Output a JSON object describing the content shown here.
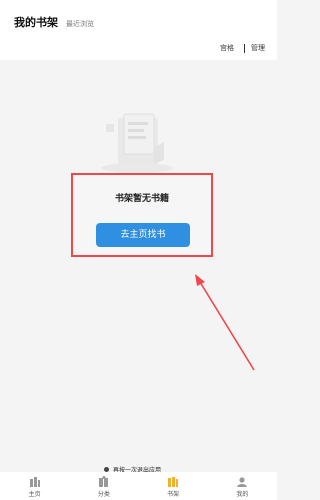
{
  "header": {
    "tab_active": "我的书架",
    "tab_inactive": "最近浏览",
    "tool_grid": "宫格",
    "tool_manage": "管理"
  },
  "empty_state": {
    "title": "书架暂无书籍",
    "button": "去主页找书"
  },
  "toast": {
    "text": "再按一次退出应用"
  },
  "bottom_nav": {
    "items": [
      {
        "label": "主页",
        "icon": "book-stack-icon"
      },
      {
        "label": "分类",
        "icon": "category-icon"
      },
      {
        "label": "书架",
        "icon": "bookshelf-icon",
        "active": true
      },
      {
        "label": "我的",
        "icon": "user-icon"
      }
    ]
  },
  "colors": {
    "accent": "#2f8fe0",
    "highlight_border": "#f0474a",
    "nav_active": "#f2b12c"
  }
}
